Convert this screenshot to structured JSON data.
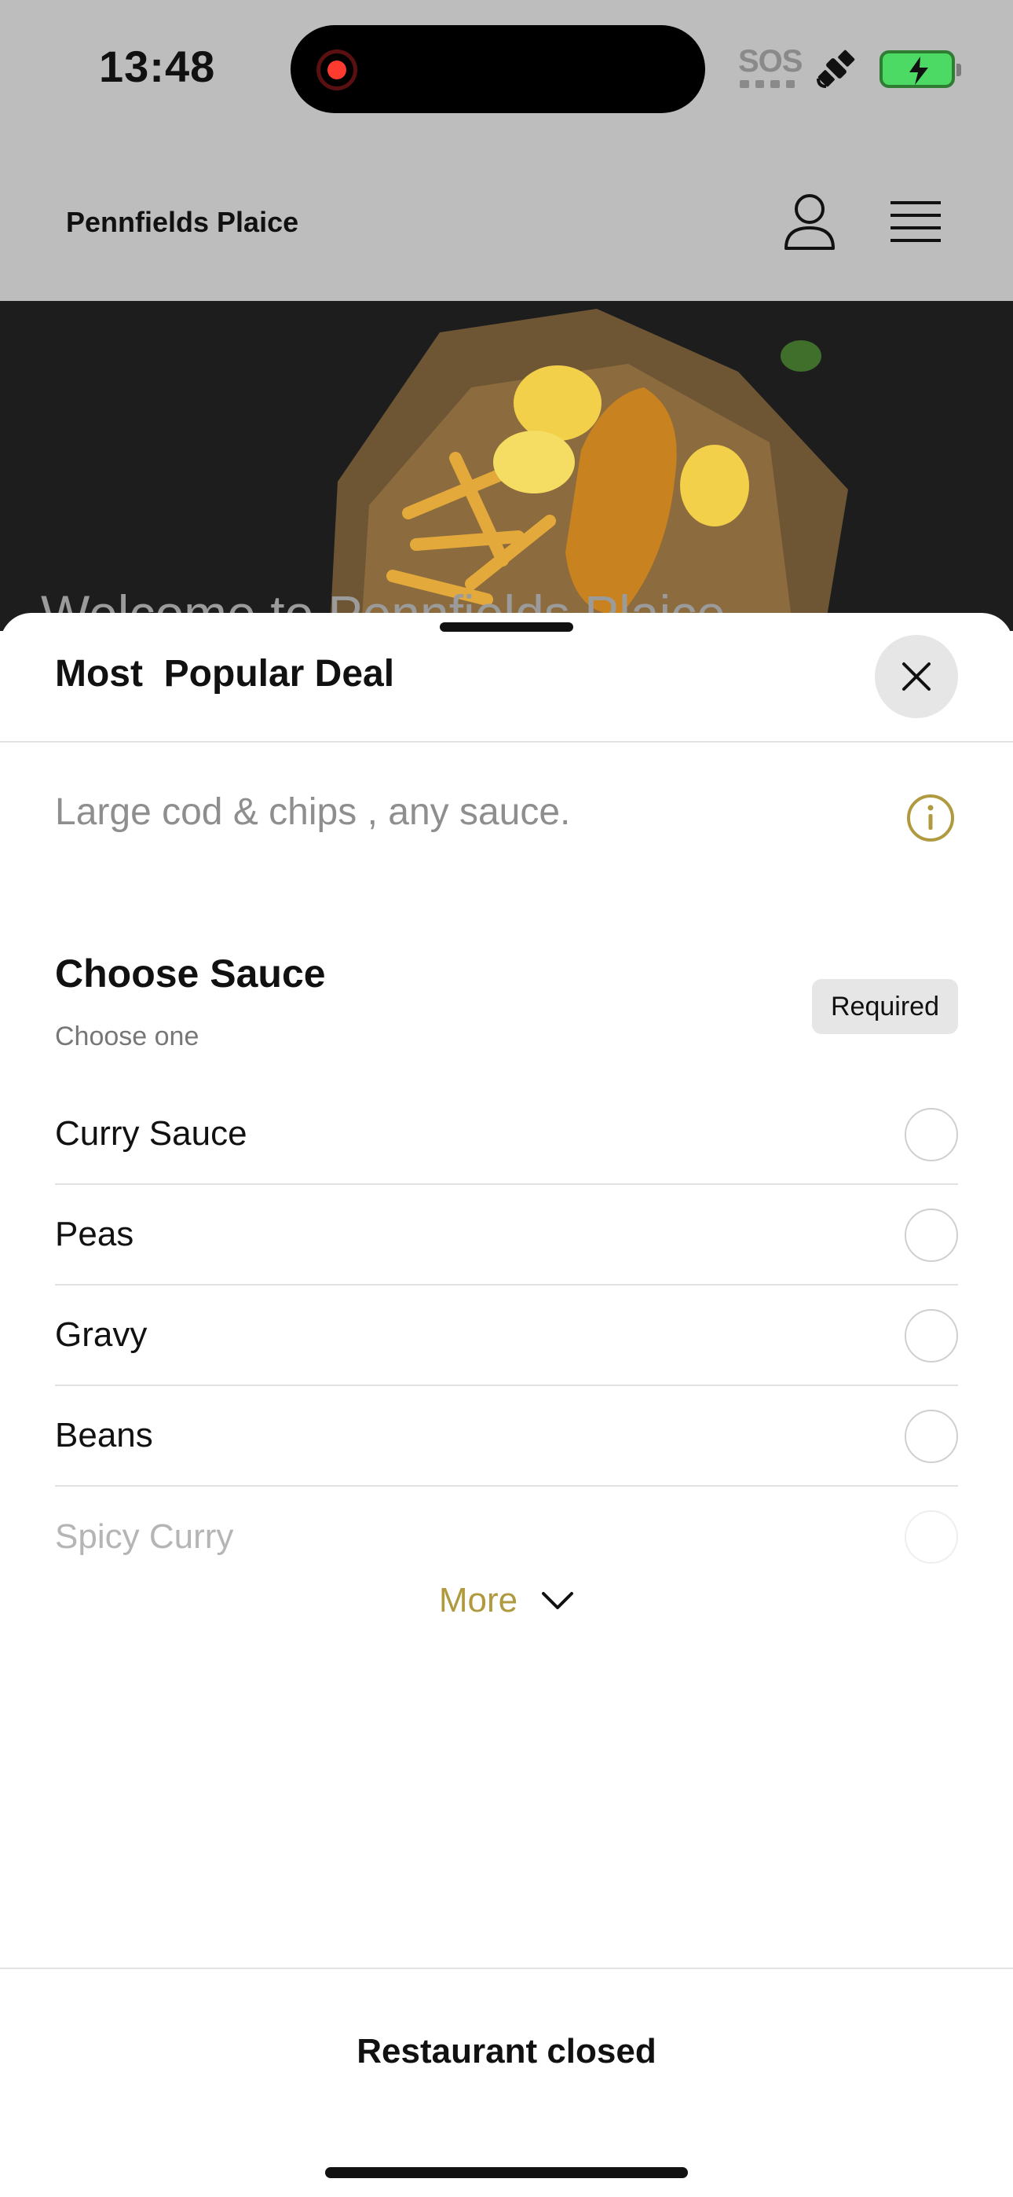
{
  "status_bar": {
    "time": "13:48",
    "sos": "SOS",
    "icons": [
      "screen-recording-icon",
      "satellite-icon",
      "battery-charging-icon"
    ],
    "battery_color": "#4cd964"
  },
  "header": {
    "brand": "Pennfields Plaice",
    "icons": [
      "user-icon",
      "menu-icon"
    ],
    "background": "#bdbdbd"
  },
  "hero": {
    "text": "Welcome to Pennfields Plaice"
  },
  "sheet": {
    "title": "Most  Popular Deal",
    "description": "Large cod & chips , any sauce.",
    "group": {
      "title": "Choose Sauce",
      "subtitle": "Choose one",
      "badge": "Required",
      "options": [
        {
          "label": "Curry Sauce"
        },
        {
          "label": "Peas"
        },
        {
          "label": "Gravy"
        },
        {
          "label": "Beans"
        },
        {
          "label": "Spicy Curry"
        }
      ]
    },
    "more_label": "More",
    "accent_color": "#b09a3f"
  },
  "footer": {
    "status": "Restaurant closed"
  }
}
